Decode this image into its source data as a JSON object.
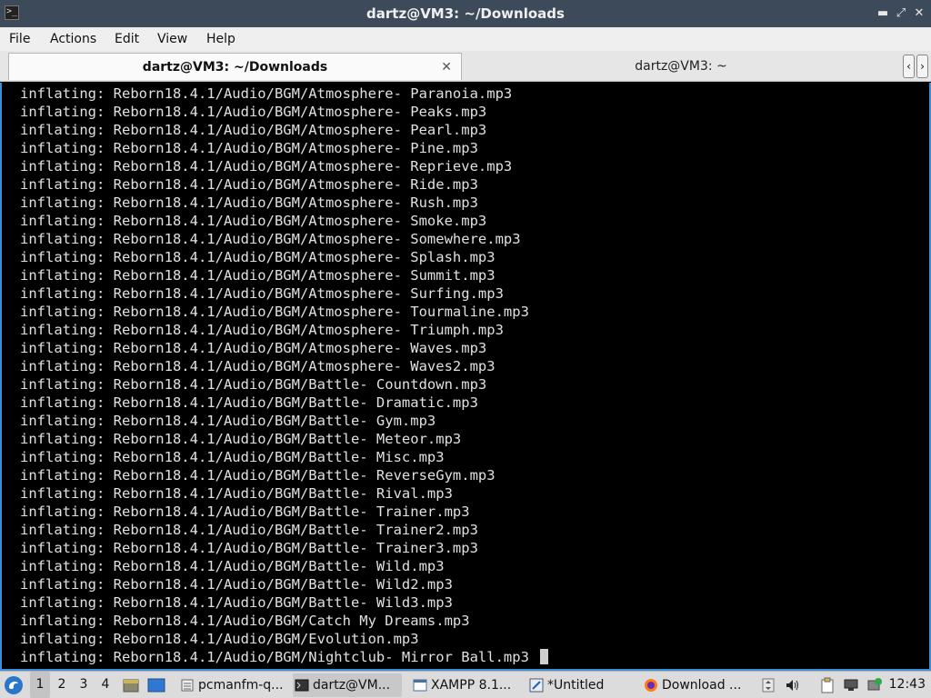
{
  "window": {
    "title": "dartz@VM3: ~/Downloads"
  },
  "menubar": {
    "items": [
      "File",
      "Actions",
      "Edit",
      "View",
      "Help"
    ]
  },
  "tabs": [
    {
      "label": "dartz@VM3: ~/Downloads",
      "active": true
    },
    {
      "label": "dartz@VM3: ~",
      "active": false
    }
  ],
  "terminal": {
    "lines": [
      "inflating: Reborn18.4.1/Audio/BGM/Atmosphere- Paranoia.mp3",
      "inflating: Reborn18.4.1/Audio/BGM/Atmosphere- Peaks.mp3",
      "inflating: Reborn18.4.1/Audio/BGM/Atmosphere- Pearl.mp3",
      "inflating: Reborn18.4.1/Audio/BGM/Atmosphere- Pine.mp3",
      "inflating: Reborn18.4.1/Audio/BGM/Atmosphere- Reprieve.mp3",
      "inflating: Reborn18.4.1/Audio/BGM/Atmosphere- Ride.mp3",
      "inflating: Reborn18.4.1/Audio/BGM/Atmosphere- Rush.mp3",
      "inflating: Reborn18.4.1/Audio/BGM/Atmosphere- Smoke.mp3",
      "inflating: Reborn18.4.1/Audio/BGM/Atmosphere- Somewhere.mp3",
      "inflating: Reborn18.4.1/Audio/BGM/Atmosphere- Splash.mp3",
      "inflating: Reborn18.4.1/Audio/BGM/Atmosphere- Summit.mp3",
      "inflating: Reborn18.4.1/Audio/BGM/Atmosphere- Surfing.mp3",
      "inflating: Reborn18.4.1/Audio/BGM/Atmosphere- Tourmaline.mp3",
      "inflating: Reborn18.4.1/Audio/BGM/Atmosphere- Triumph.mp3",
      "inflating: Reborn18.4.1/Audio/BGM/Atmosphere- Waves.mp3",
      "inflating: Reborn18.4.1/Audio/BGM/Atmosphere- Waves2.mp3",
      "inflating: Reborn18.4.1/Audio/BGM/Battle- Countdown.mp3",
      "inflating: Reborn18.4.1/Audio/BGM/Battle- Dramatic.mp3",
      "inflating: Reborn18.4.1/Audio/BGM/Battle- Gym.mp3",
      "inflating: Reborn18.4.1/Audio/BGM/Battle- Meteor.mp3",
      "inflating: Reborn18.4.1/Audio/BGM/Battle- Misc.mp3",
      "inflating: Reborn18.4.1/Audio/BGM/Battle- ReverseGym.mp3",
      "inflating: Reborn18.4.1/Audio/BGM/Battle- Rival.mp3",
      "inflating: Reborn18.4.1/Audio/BGM/Battle- Trainer.mp3",
      "inflating: Reborn18.4.1/Audio/BGM/Battle- Trainer2.mp3",
      "inflating: Reborn18.4.1/Audio/BGM/Battle- Trainer3.mp3",
      "inflating: Reborn18.4.1/Audio/BGM/Battle- Wild.mp3",
      "inflating: Reborn18.4.1/Audio/BGM/Battle- Wild2.mp3",
      "inflating: Reborn18.4.1/Audio/BGM/Battle- Wild3.mp3",
      "inflating: Reborn18.4.1/Audio/BGM/Catch My Dreams.mp3",
      "inflating: Reborn18.4.1/Audio/BGM/Evolution.mp3",
      "inflating: Reborn18.4.1/Audio/BGM/Nightclub- Mirror Ball.mp3"
    ]
  },
  "taskbar": {
    "workspaces": [
      "1",
      "2",
      "3",
      "4"
    ],
    "tasks": [
      {
        "label": "pcmanfm-q...",
        "icon": "file-manager-icon"
      },
      {
        "label": "dartz@VM...",
        "icon": "terminal-icon"
      },
      {
        "label": "XAMPP 8.1...",
        "icon": "window-icon"
      },
      {
        "label": "*Untitled",
        "icon": "text-editor-icon"
      },
      {
        "label": "Download ...",
        "icon": "firefox-icon"
      }
    ],
    "clock": "12:43"
  }
}
